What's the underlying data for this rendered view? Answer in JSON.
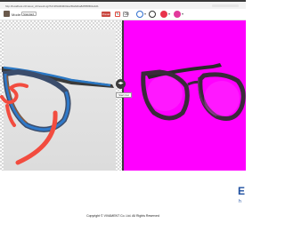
{
  "window": {
    "title": "http://localhost.cf/cutout_cli/result.cgi?id=2f9d4b9b02e2f0a6dba8d5f58fb0e3d1"
  },
  "toolbar": {
    "mode_label": "Mode:",
    "mode_value": "Standard",
    "preset_label": "Preset",
    "tools": [
      {
        "name": "pen-tool",
        "glyph": "✎"
      },
      {
        "name": "eraser-tool",
        "glyph": "⌫"
      }
    ],
    "colors": {
      "keep": "#2f6fcf",
      "neutral": "#333333",
      "remove": "#e8334a",
      "background": "#e23a9c"
    }
  },
  "editor": {
    "compare_label": "Start Cut",
    "handle_glyph": "◂▸",
    "result_background": "#ff00ff"
  },
  "footer": {
    "copyright": "Copyright © VIVAMENT Co. Ltd. All Rights Reserved",
    "brand": "E",
    "brand_sub": "h"
  }
}
